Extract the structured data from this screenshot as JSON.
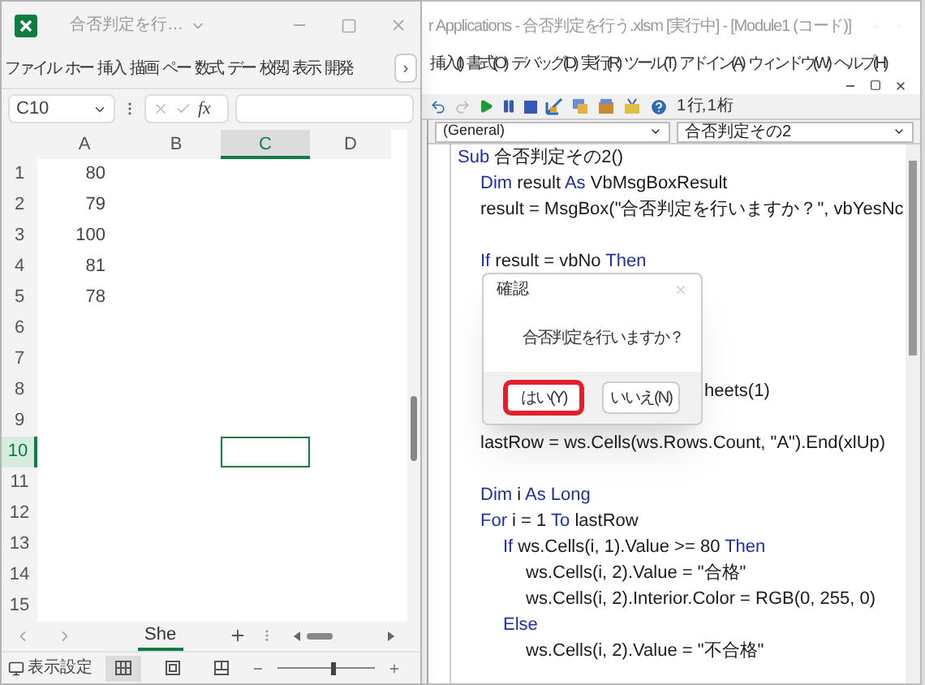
{
  "excel": {
    "title": "合否判定を行…",
    "ribbon_tabs": [
      "ファイル",
      "ホー",
      "挿入",
      "描画",
      "ペー",
      "数式",
      "デー",
      "校閲",
      "表示",
      "開発"
    ],
    "more_button": "›",
    "name_box": "C10",
    "fx": "fx",
    "columns": [
      {
        "label": "A",
        "selected": false
      },
      {
        "label": "B",
        "selected": false
      },
      {
        "label": "C",
        "selected": true
      },
      {
        "label": "D",
        "selected": false
      }
    ],
    "rows": [
      {
        "label": "1",
        "value": "80",
        "selected": false
      },
      {
        "label": "2",
        "value": "79",
        "selected": false
      },
      {
        "label": "3",
        "value": "100",
        "selected": false
      },
      {
        "label": "4",
        "value": "81",
        "selected": false
      },
      {
        "label": "5",
        "value": "78",
        "selected": false
      },
      {
        "label": "6",
        "value": "",
        "selected": false
      },
      {
        "label": "7",
        "value": "",
        "selected": false
      },
      {
        "label": "8",
        "value": "",
        "selected": false
      },
      {
        "label": "9",
        "value": "",
        "selected": false
      },
      {
        "label": "10",
        "value": "",
        "selected": true
      },
      {
        "label": "11",
        "value": "",
        "selected": false
      },
      {
        "label": "12",
        "value": "",
        "selected": false
      },
      {
        "label": "13",
        "value": "",
        "selected": false
      },
      {
        "label": "14",
        "value": "",
        "selected": false
      },
      {
        "label": "15",
        "value": "",
        "selected": false
      }
    ],
    "sheet_tab": {
      "label": "She",
      "selected": true
    },
    "status_label": "表示設定",
    "views": [
      {
        "kind": "normal",
        "selected": true
      },
      {
        "kind": "page-layout",
        "selected": false
      },
      {
        "kind": "page-break",
        "selected": false
      }
    ],
    "zoom": {
      "level": 0.55
    }
  },
  "vba": {
    "title": "r Applications - 合否判定を行う.xlsm [実行中] - [Module1 (コード)]",
    "menu": [
      "挿入(I)",
      "書式(O)",
      "デバッグ(D)",
      "実行(R)",
      "ツール(T)",
      "アドイン(A)",
      "ウィンドウ(W)",
      "ヘルプ(H)"
    ],
    "position": "1 行, 1 桁",
    "object_dropdown": "(General)",
    "procedure_dropdown": "合否判定その2",
    "code": [
      {
        "kind": "line",
        "parts": [
          {
            "kind": "keyword",
            "t": "Sub"
          },
          {
            "kind": "plain",
            "t": " 合否判定その2()"
          }
        ],
        "children": [
          {
            "kind": "line",
            "parts": [
              {
                "kind": "keyword",
                "t": "Dim"
              },
              {
                "kind": "plain",
                "t": " result "
              },
              {
                "kind": "keyword",
                "t": "As"
              },
              {
                "kind": "plain",
                "t": " VbMsgBoxResult"
              }
            ]
          },
          {
            "kind": "line",
            "parts": [
              {
                "kind": "plain",
                "t": "result = MsgBox(\"合否判定を行いますか？\", vbYesNc"
              }
            ]
          },
          {
            "kind": "blank"
          },
          {
            "kind": "line",
            "parts": [
              {
                "kind": "keyword",
                "t": "If"
              },
              {
                "kind": "plain",
                "t": " result = vbNo "
              },
              {
                "kind": "keyword",
                "t": "Then"
              }
            ]
          },
          {
            "kind": "blank"
          },
          {
            "kind": "blank"
          },
          {
            "kind": "blank"
          },
          {
            "kind": "blank"
          },
          {
            "kind": "fragment",
            "parts": [
              {
                "kind": "plain",
                "t": "heets(1)"
              }
            ]
          },
          {
            "kind": "blank"
          },
          {
            "kind": "line",
            "parts": [
              {
                "kind": "plain",
                "t": "lastRow = ws.Cells(ws.Rows.Count, \"A\").End(xlUp)"
              }
            ]
          },
          {
            "kind": "blank"
          },
          {
            "kind": "line",
            "parts": [
              {
                "kind": "keyword",
                "t": "Dim"
              },
              {
                "kind": "plain",
                "t": " i "
              },
              {
                "kind": "keyword",
                "t": "As Long"
              }
            ]
          },
          {
            "kind": "line",
            "parts": [
              {
                "kind": "keyword",
                "t": "For"
              },
              {
                "kind": "plain",
                "t": " i = 1 "
              },
              {
                "kind": "keyword",
                "t": "To"
              },
              {
                "kind": "plain",
                "t": " lastRow"
              }
            ],
            "children": [
              {
                "kind": "line",
                "parts": [
                  {
                    "kind": "keyword",
                    "t": "If"
                  },
                  {
                    "kind": "plain",
                    "t": " ws.Cells(i, 1).Value >= 80 "
                  },
                  {
                    "kind": "keyword",
                    "t": "Then"
                  }
                ],
                "children": [
                  {
                    "kind": "line",
                    "parts": [
                      {
                        "kind": "plain",
                        "t": "ws.Cells(i, 2).Value = \"合格\""
                      }
                    ]
                  },
                  {
                    "kind": "line",
                    "parts": [
                      {
                        "kind": "plain",
                        "t": "ws.Cells(i, 2).Interior.Color = RGB(0, 255, 0)"
                      }
                    ]
                  }
                ]
              },
              {
                "kind": "line",
                "parts": [
                  {
                    "kind": "keyword",
                    "t": "Else"
                  }
                ],
                "children": [
                  {
                    "kind": "line",
                    "parts": [
                      {
                        "kind": "plain",
                        "t": "ws.Cells(i, 2).Value = \"不合格\""
                      }
                    ]
                  }
                ]
              }
            ]
          }
        ]
      }
    ],
    "dialog": {
      "title": "確認",
      "message": "合否判定を行いますか？",
      "buttons": [
        {
          "label": "はい(Y)",
          "selected": true
        },
        {
          "label": "いいえ(N)",
          "selected": false
        }
      ]
    }
  }
}
